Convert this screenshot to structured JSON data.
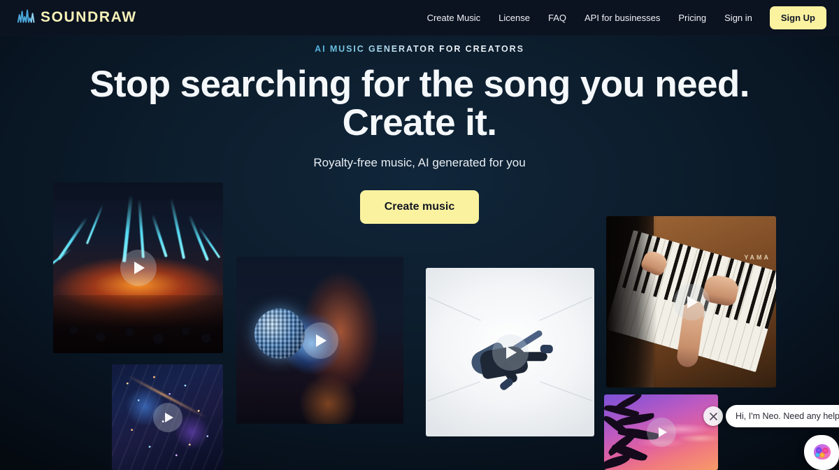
{
  "brand": {
    "name": "SOUNDRAW",
    "logo_icon": "waveform-icon",
    "accent_yellow": "#fbf2a0",
    "logo_wave_color": "#4aa6d8"
  },
  "nav": {
    "links": [
      {
        "label": "Create Music",
        "name": "nav-create-music"
      },
      {
        "label": "License",
        "name": "nav-license"
      },
      {
        "label": "FAQ",
        "name": "nav-faq"
      },
      {
        "label": "API for businesses",
        "name": "nav-api-for-businesses"
      },
      {
        "label": "Pricing",
        "name": "nav-pricing"
      },
      {
        "label": "Sign in",
        "name": "nav-sign-in"
      }
    ],
    "signup_label": "Sign Up"
  },
  "hero": {
    "eyebrow": "AI MUSIC GENERATOR FOR CREATORS",
    "headline_line1": "Stop searching for the song you need.",
    "headline_line2": "Create it.",
    "subtitle": "Royalty-free music, AI generated for you",
    "cta_label": "Create music"
  },
  "tiles": [
    {
      "name": "tile-concert-lasers",
      "alt": "Concert stage with blue laser beams over a crowd",
      "play_icon": "play-icon"
    },
    {
      "name": "tile-city-night",
      "alt": "Aerial view of a neon-lit city at night",
      "play_icon": "play-icon"
    },
    {
      "name": "tile-disco-woman",
      "alt": "Woman holding a mirrored disco ball",
      "play_icon": "play-icon"
    },
    {
      "name": "tile-breakdancer",
      "alt": "Breakdancer mid-move in a bright white corridor",
      "play_icon": "play-icon"
    },
    {
      "name": "tile-piano-hands",
      "alt": "Hands playing an upright Yamaha piano",
      "play_icon": "play-icon"
    },
    {
      "name": "tile-palm-sunset",
      "alt": "Palm trees silhouetted against a purple and pink sunset",
      "play_icon": "play-icon"
    }
  ],
  "piano_brand_text": "YAMA",
  "chat": {
    "message": "Hi, I'm Neo. Need any help?",
    "close_icon": "close-icon",
    "launcher_icon": "chat-avatar-icon"
  }
}
